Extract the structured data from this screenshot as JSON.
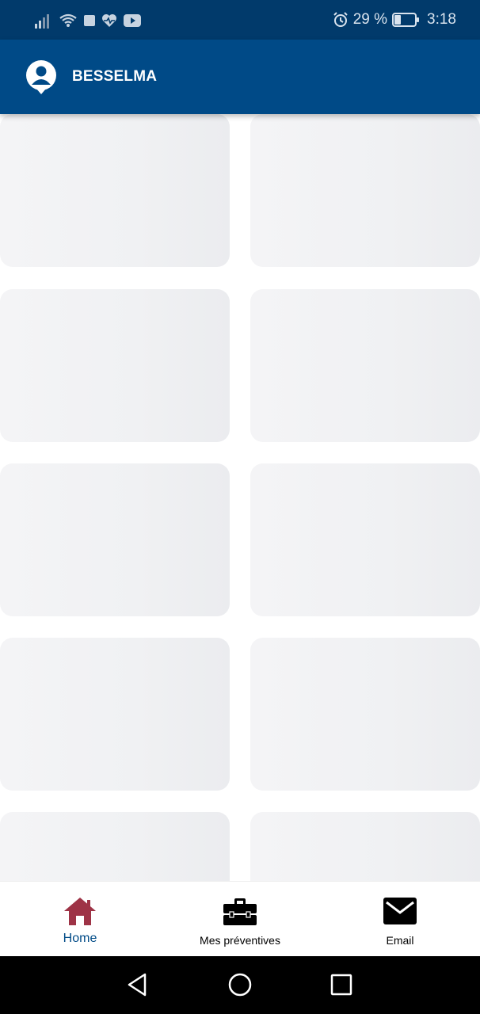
{
  "status_bar": {
    "battery_percent": "29 %",
    "time": "3:18",
    "icons": [
      "signal-icon",
      "wifi-icon",
      "stop-icon",
      "heart-rate-icon",
      "youtube-icon",
      "alarm-icon",
      "battery-icon"
    ]
  },
  "app_bar": {
    "title": "BESSELMA",
    "avatar_icon": "account-icon"
  },
  "content": {
    "loading_tiles": 10
  },
  "bottom_nav": {
    "items": [
      {
        "label": "Home",
        "icon": "home-icon",
        "active": true
      },
      {
        "label": "Mes préventives",
        "icon": "toolbox-icon",
        "active": false
      },
      {
        "label": "Email",
        "icon": "mail-icon",
        "active": false
      }
    ],
    "active_color": "#9e3346",
    "active_label_color": "#014b87"
  },
  "system_nav": {
    "buttons": [
      "back-button",
      "home-button",
      "recents-button"
    ]
  },
  "colors": {
    "status_bar": "#013a6b",
    "app_bar": "#004a87",
    "tile": "#f0f1f3"
  }
}
